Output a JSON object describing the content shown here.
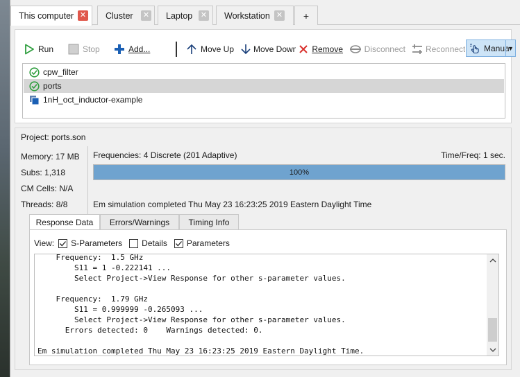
{
  "tabs": [
    {
      "label": "This computer",
      "active": true
    },
    {
      "label": "Cluster",
      "active": false
    },
    {
      "label": "Laptop",
      "active": false
    },
    {
      "label": "Workstation",
      "active": false
    },
    {
      "label": "+",
      "active": false
    }
  ],
  "toolbar": {
    "run": "Run",
    "stop": "Stop",
    "add": "Add...",
    "move_up": "Move Up",
    "move_down": "Move Down",
    "remove": "Remove",
    "disconnect": "Disconnect",
    "reconnect": "Reconnect",
    "manual": "Manual"
  },
  "projects": [
    {
      "name": "cpw_filter",
      "status": "completed",
      "selected": false
    },
    {
      "name": "ports",
      "status": "completed",
      "selected": true
    },
    {
      "name": "1nH_oct_inductor-example",
      "status": "queued",
      "selected": false
    }
  ],
  "project_panel": {
    "title": "Project:  ports.son",
    "memory": "Memory: 17 MB",
    "subs": "Subs: 1,318",
    "cm_cells": "CM Cells: N/A",
    "threads": "Threads: 8/8",
    "frequencies": "Frequencies:  4 Discrete (201 Adaptive)",
    "time_freq": "Time/Freq:  1 sec.",
    "progress_label": "100%",
    "progress": 1.0,
    "status": "Em simulation completed Thu May 23 16:23:25 2019 Eastern Daylight Time"
  },
  "subtabs": [
    {
      "label": "Response Data",
      "active": true
    },
    {
      "label": "Errors/Warnings",
      "active": false
    },
    {
      "label": "Timing Info",
      "active": false
    }
  ],
  "view": {
    "label": "View:",
    "options": [
      {
        "label": "S-Parameters",
        "checked": true
      },
      {
        "label": "Details",
        "checked": false
      },
      {
        "label": "Parameters",
        "checked": true
      }
    ]
  },
  "log_lines": [
    "    Frequency:  1.5 GHz",
    "        S11 = 1 -0.222141 ...",
    "        Select Project->View Response for other s-parameter values.",
    "",
    "    Frequency:  1.79 GHz",
    "        S11 = 0.999999 -0.265093 ...",
    "        Select Project->View Response for other s-parameter values.",
    "      Errors detected: 0    Warnings detected: 0.",
    "",
    "Em simulation completed Thu May 23 16:23:25 2019 Eastern Daylight Time."
  ],
  "colors": {
    "accent": "#6fa3cf",
    "run_green": "#2e9e3e",
    "add_blue": "#1a5fb4",
    "remove_red": "#d9302c",
    "tab_close_active": "#e0584c"
  }
}
